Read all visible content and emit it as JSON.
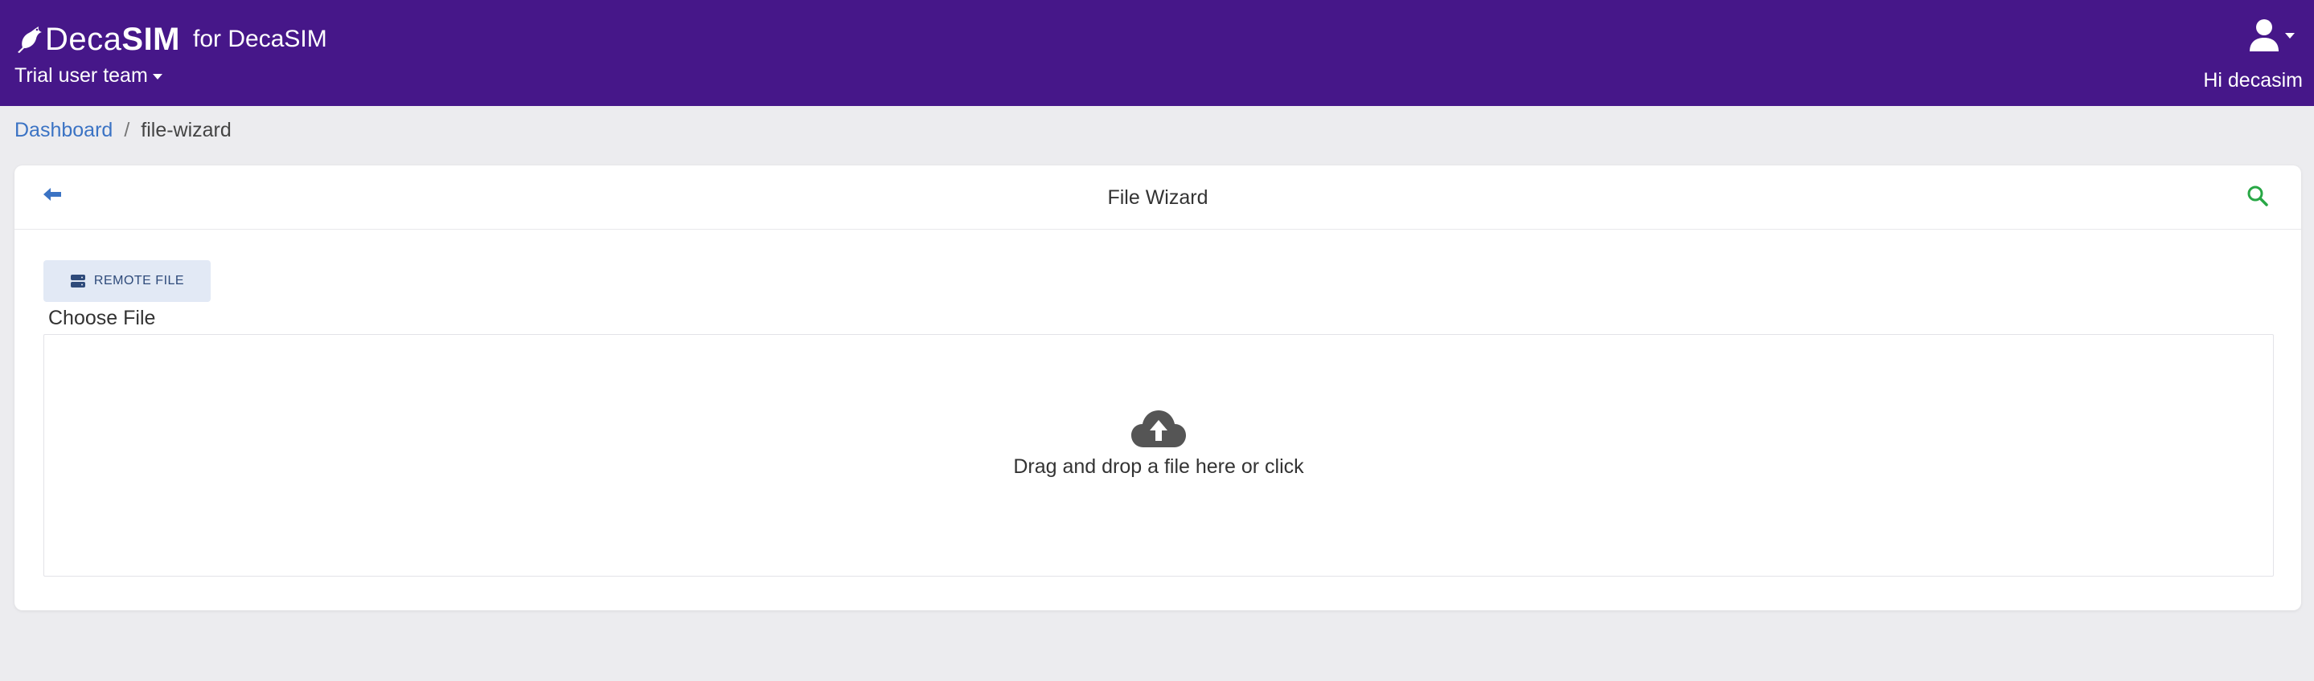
{
  "header": {
    "brand_deca": "Deca",
    "brand_sim": "SIM",
    "brand_for": "for DecaSIM",
    "team_label": "Trial user team",
    "greeting": "Hi decasim",
    "bg_color": "#461789"
  },
  "breadcrumb": {
    "items": [
      {
        "label": "Dashboard"
      },
      {
        "label": "/"
      },
      {
        "label": "file-wizard"
      }
    ]
  },
  "card": {
    "title": "File Wizard",
    "remote_file_label": "REMOTE FILE",
    "choose_file_label": "Choose File",
    "dropzone_text": "Drag and drop a file here or click"
  },
  "icons": {
    "back": "arrow-left-icon",
    "search": "search-icon",
    "server": "server-icon",
    "upload": "cloud-upload-icon",
    "user": "user-icon",
    "logo": "bird-icon"
  },
  "colors": {
    "accent_link": "#3b73c4",
    "search_green": "#28a745",
    "button_bg": "#e2e9f5"
  }
}
